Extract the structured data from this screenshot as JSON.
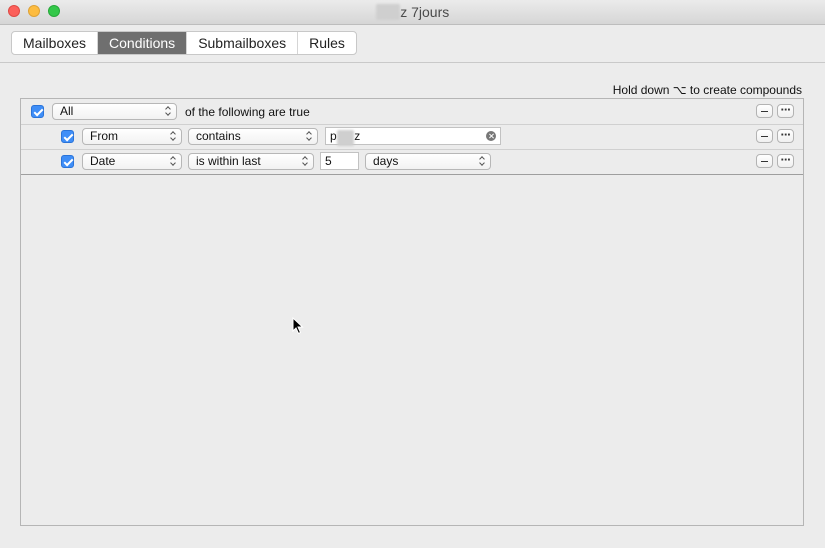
{
  "window": {
    "title_hidden": "•••••",
    "title_suffix": "z 7jours"
  },
  "tabs": [
    {
      "label": "Mailboxes",
      "active": false
    },
    {
      "label": "Conditions",
      "active": true
    },
    {
      "label": "Submailboxes",
      "active": false
    },
    {
      "label": "Rules",
      "active": false
    }
  ],
  "hint": "Hold down ⌥ to create compounds",
  "conditions": {
    "match": {
      "checked": true,
      "value": "All",
      "suffix": "of the following are true"
    },
    "rows": [
      {
        "checked": true,
        "field": "From",
        "operator": "contains",
        "value_prefix": "p",
        "value_hidden": "•••••",
        "value_suffix": "z"
      },
      {
        "checked": true,
        "field": "Date",
        "operator": "is within last",
        "value": "5",
        "unit": "days"
      }
    ]
  },
  "colors": {
    "accent": "#3f8ef7",
    "active_tab": "#6f6f6f"
  }
}
